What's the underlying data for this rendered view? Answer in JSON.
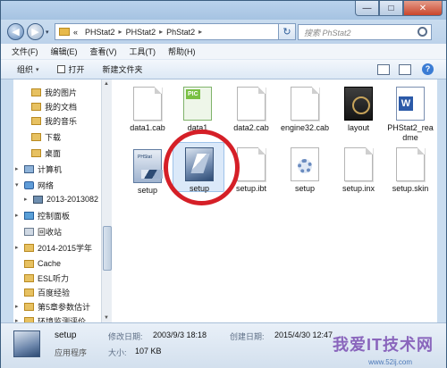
{
  "window": {
    "controls": {
      "minimize": "—",
      "maximize": "□",
      "close": "✕"
    }
  },
  "address": {
    "prefix": "«",
    "crumbs": [
      "PHStat2",
      "PHStat2",
      "PhStat2"
    ],
    "separator": "▸",
    "dropdown": "▾",
    "refresh": "↻"
  },
  "search": {
    "placeholder": "搜索 PhStat2"
  },
  "menu": [
    "文件(F)",
    "编辑(E)",
    "查看(V)",
    "工具(T)",
    "帮助(H)"
  ],
  "toolbar": {
    "organize": "组织",
    "organize_dd": "▾",
    "open": "打开",
    "new_folder": "新建文件夹",
    "help": "?"
  },
  "nav": {
    "items": [
      {
        "label": "我的图片",
        "icon": "folder-icon"
      },
      {
        "label": "我的文档",
        "icon": "folder-icon"
      },
      {
        "label": "我的音乐",
        "icon": "folder-icon"
      },
      {
        "label": "下载",
        "icon": "folder-icon"
      },
      {
        "label": "桌面",
        "icon": "folder-icon"
      },
      {
        "label": "计算机",
        "icon": "computer-icon"
      },
      {
        "label": "网络",
        "icon": "network-icon"
      },
      {
        "label": "2013-2013082",
        "icon": "pc-icon"
      },
      {
        "label": "控制面板",
        "icon": "control-panel-icon"
      },
      {
        "label": "回收站",
        "icon": "trash-icon"
      },
      {
        "label": "2014-2015学年",
        "icon": "folder-icon"
      },
      {
        "label": "Cache",
        "icon": "folder-icon"
      },
      {
        "label": "ESL听力",
        "icon": "folder-icon"
      },
      {
        "label": "百度经验",
        "icon": "folder-icon"
      },
      {
        "label": "第5章参数估计",
        "icon": "folder-icon"
      },
      {
        "label": "环境监测评价",
        "icon": "folder-icon"
      }
    ]
  },
  "files": [
    {
      "name": "data1.cab",
      "kind": "page"
    },
    {
      "name": "data1",
      "kind": "pic",
      "tag": "PIC"
    },
    {
      "name": "data2.cab",
      "kind": "page"
    },
    {
      "name": "engine32.cab",
      "kind": "page"
    },
    {
      "name": "layout",
      "kind": "layout"
    },
    {
      "name": "PHStat2_readme",
      "kind": "word"
    },
    {
      "name": "setup",
      "kind": "setup-wide"
    },
    {
      "name": "setup",
      "kind": "setup-sel"
    },
    {
      "name": "setup.ibt",
      "kind": "page"
    },
    {
      "name": "setup",
      "kind": "gear"
    },
    {
      "name": "setup.inx",
      "kind": "page"
    },
    {
      "name": "setup.skin",
      "kind": "page"
    }
  ],
  "details": {
    "name": "setup",
    "type": "应用程序",
    "modified_label": "修改日期:",
    "modified": "2003/9/3 18:18",
    "created_label": "创建日期:",
    "created": "2015/4/30 12:47",
    "size_label": "大小:",
    "size": "107 KB"
  },
  "watermark": {
    "text": "我爱IT技术网",
    "sub": "www.52ij.com"
  },
  "colors": {
    "highlight_ring": "#d51f27",
    "selection": "#dbe9f9"
  }
}
